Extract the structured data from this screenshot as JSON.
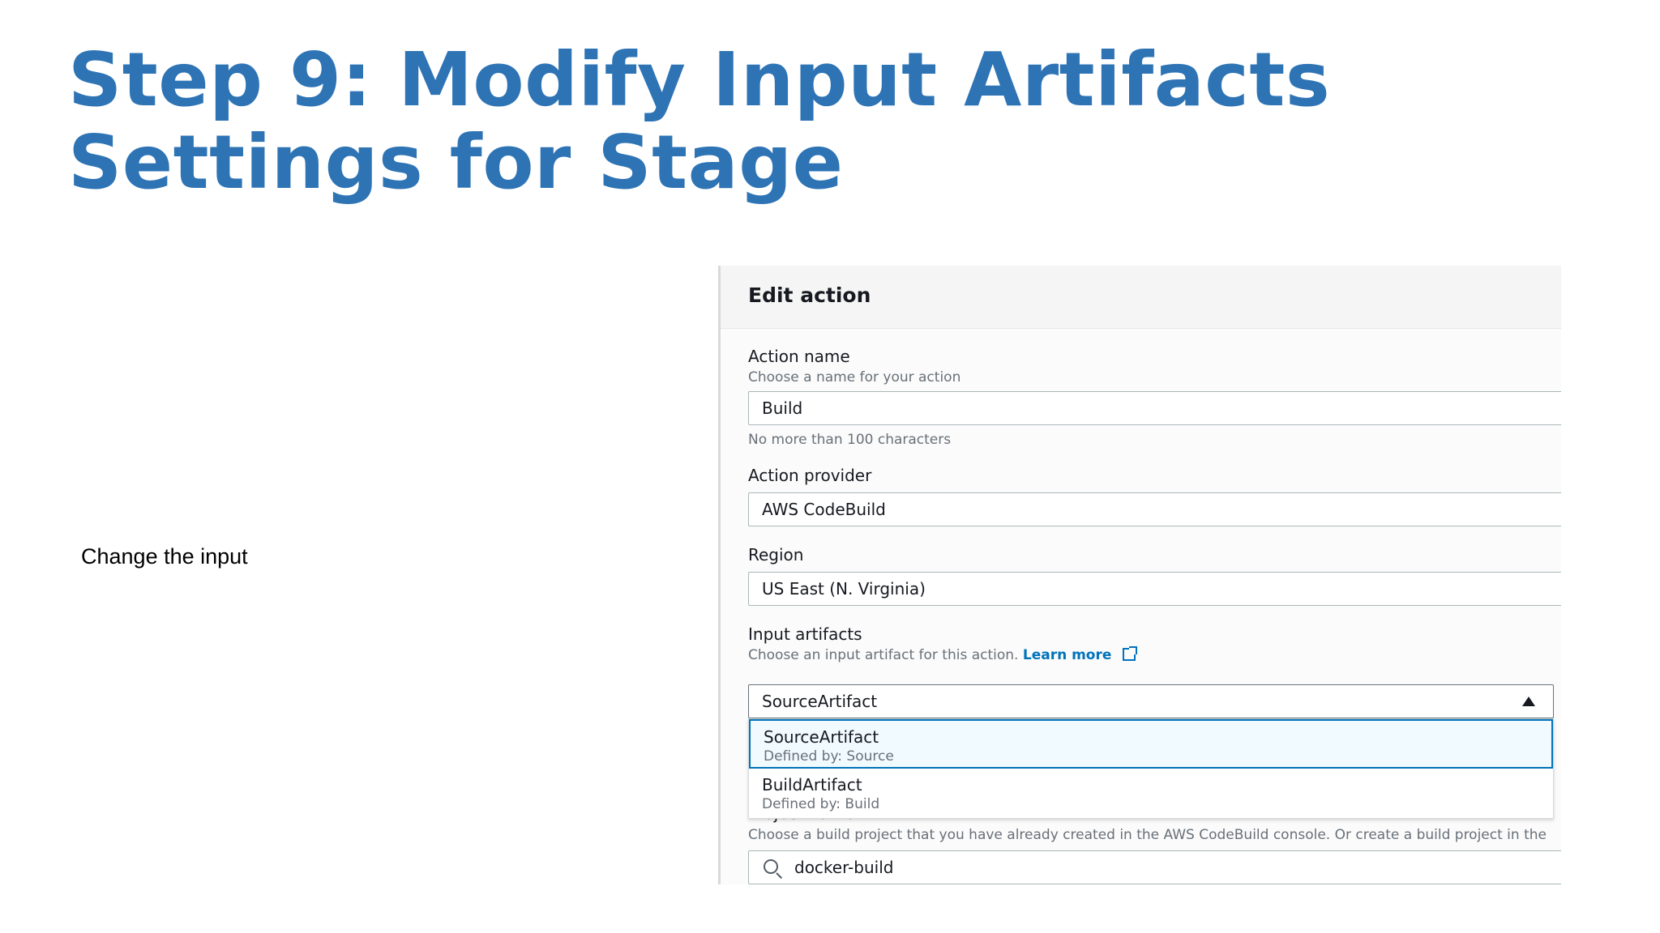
{
  "slide": {
    "title_line1": "Step 9: Modify Input Artifacts",
    "title_line2": "Settings for Stage",
    "bullet": "Change the input"
  },
  "edit_action": {
    "header": "Edit action",
    "action_name": {
      "label": "Action name",
      "hint": "Choose a name for your action",
      "value": "Build",
      "constraint": "No more than 100 characters"
    },
    "action_provider": {
      "label": "Action provider",
      "value": "AWS CodeBuild"
    },
    "region": {
      "label": "Region",
      "value": "US East (N. Virginia)"
    },
    "input_artifacts": {
      "label": "Input artifacts",
      "hint": "Choose an input artifact for this action.",
      "learn_more": "Learn more",
      "selected": "SourceArtifact",
      "options": [
        {
          "title": "SourceArtifact",
          "sub": "Defined by: Source",
          "selected": true
        },
        {
          "title": "BuildArtifact",
          "sub": "Defined by: Build",
          "selected": false
        }
      ]
    },
    "project_name": {
      "label": "Project name",
      "hint": "Choose a build project that you have already created in the AWS CodeBuild console. Or create a build project in the",
      "value": "docker-build"
    }
  },
  "icons": {
    "external_link": "external-link-icon",
    "dropdown_caret": "caret-up-icon",
    "search": "search-icon"
  },
  "colors": {
    "title": "#2e74b5",
    "link": "#0073bb",
    "selected_option_border": "#0073bb"
  }
}
